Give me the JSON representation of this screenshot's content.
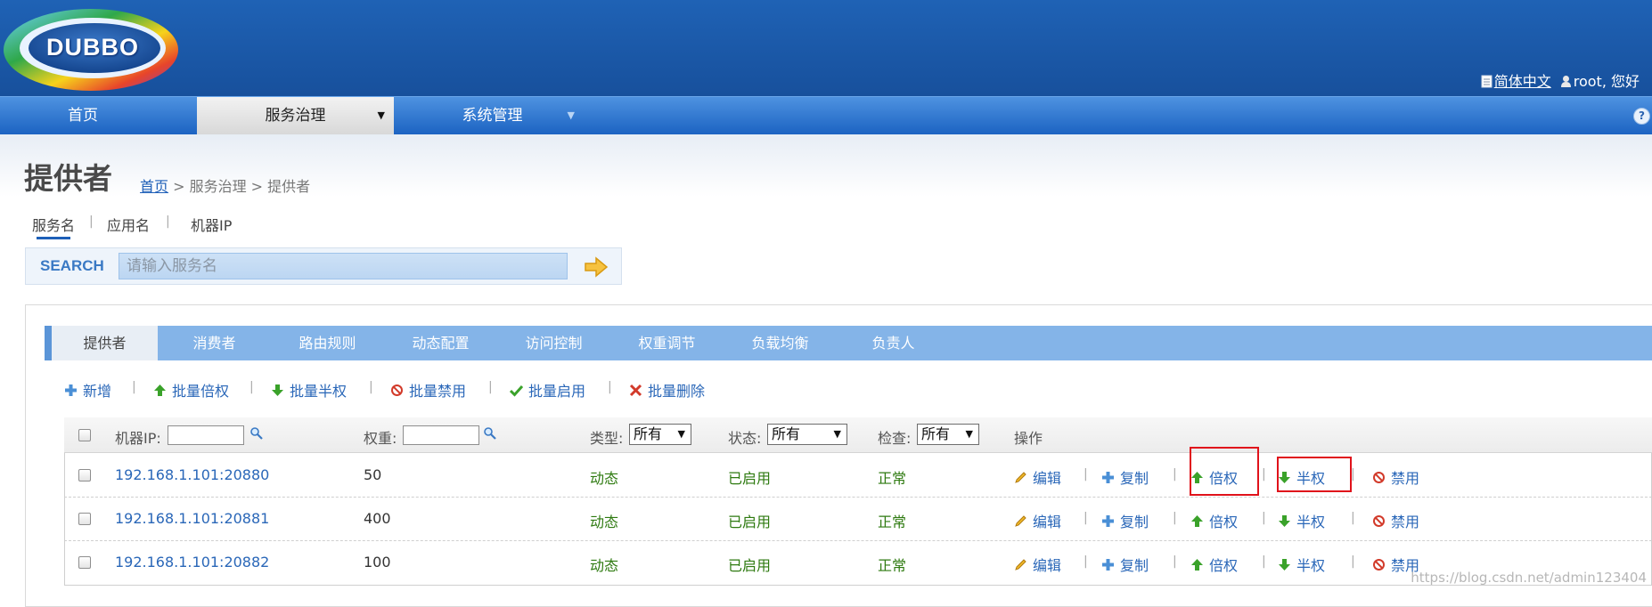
{
  "header": {
    "logo_text": "DUBBO",
    "lang_label": "简体中文",
    "user_label": "root, 您好"
  },
  "nav": {
    "items": [
      {
        "label": "首页"
      },
      {
        "label": "服务治理",
        "arrow": "▼"
      },
      {
        "label": "系统管理",
        "arrow": "▼"
      }
    ]
  },
  "page": {
    "title": "提供者",
    "breadcrumb": {
      "home": "首页",
      "rest": " > 服务治理 > 提供者"
    }
  },
  "search": {
    "tabs": [
      "服务名",
      "应用名",
      "机器IP"
    ],
    "separator": "|",
    "label": "SEARCH",
    "placeholder": "请输入服务名"
  },
  "tabs": [
    "提供者",
    "消费者",
    "路由规则",
    "动态配置",
    "访问控制",
    "权重调节",
    "负载均衡",
    "负责人"
  ],
  "toolbar": {
    "items": [
      {
        "label": "新增",
        "icon": "plus-icon"
      },
      {
        "label": "批量倍权",
        "icon": "arrow-up-icon"
      },
      {
        "label": "批量半权",
        "icon": "arrow-down-icon"
      },
      {
        "label": "批量禁用",
        "icon": "ban-icon"
      },
      {
        "label": "批量启用",
        "icon": "check-icon"
      },
      {
        "label": "批量删除",
        "icon": "x-icon"
      }
    ],
    "separator": "|"
  },
  "table": {
    "headers": {
      "ip": "机器IP:",
      "weight": "权重:",
      "type": "类型:",
      "status": "状态:",
      "check": "检查:",
      "ops": "操作"
    },
    "filters": {
      "type": "所有",
      "status": "所有",
      "check": "所有"
    },
    "rows": [
      {
        "ip": "192.168.1.101:20880",
        "weight": "50",
        "type": "动态",
        "status": "已启用",
        "check": "正常"
      },
      {
        "ip": "192.168.1.101:20881",
        "weight": "400",
        "type": "动态",
        "status": "已启用",
        "check": "正常"
      },
      {
        "ip": "192.168.1.101:20882",
        "weight": "100",
        "type": "动态",
        "status": "已启用",
        "check": "正常"
      }
    ],
    "ops": {
      "edit": "编辑",
      "copy": "复制",
      "double": "倍权",
      "half": "半权",
      "disable": "禁用"
    },
    "op_separator": "|"
  },
  "watermark": "https://blog.csdn.net/admin123404",
  "colors": {
    "header_blue": "#1f62b5",
    "link_blue": "#2a67b8",
    "status_green": "#2e7a10",
    "highlight_red": "#e0121b"
  }
}
